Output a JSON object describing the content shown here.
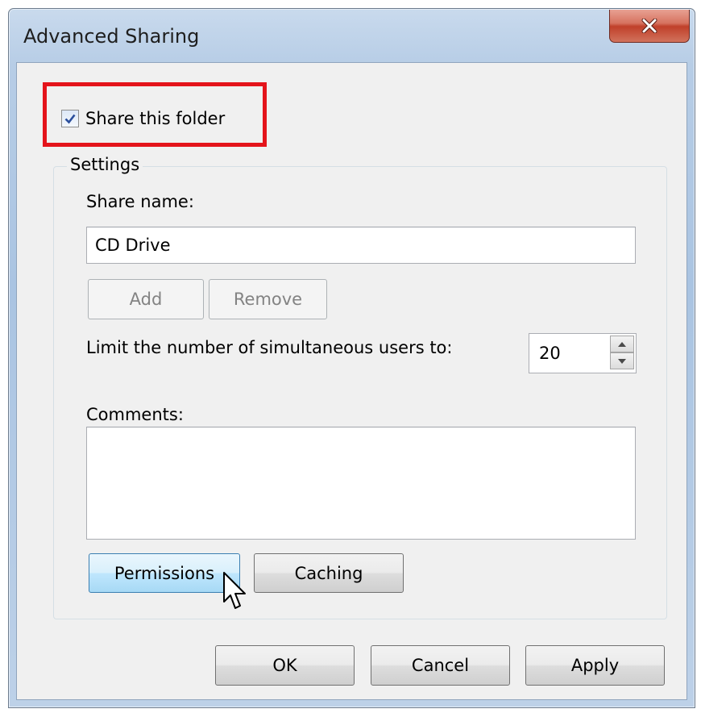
{
  "dialog": {
    "title": "Advanced Sharing",
    "close_icon": "close-icon"
  },
  "share": {
    "checkbox_label": "Share this folder",
    "checked": true
  },
  "settings": {
    "group_label": "Settings",
    "share_name_label": "Share name:",
    "share_name_value": "CD Drive",
    "add_label": "Add",
    "remove_label": "Remove",
    "limit_label": "Limit the number of simultaneous users to:",
    "limit_value": "20",
    "comments_label": "Comments:",
    "comments_value": "",
    "permissions_label": "Permissions",
    "caching_label": "Caching"
  },
  "footer": {
    "ok_label": "OK",
    "cancel_label": "Cancel",
    "apply_label": "Apply"
  },
  "colors": {
    "highlight": "#e4141b",
    "close_button": "#c0402a",
    "titlebar": "#b7cde6"
  }
}
